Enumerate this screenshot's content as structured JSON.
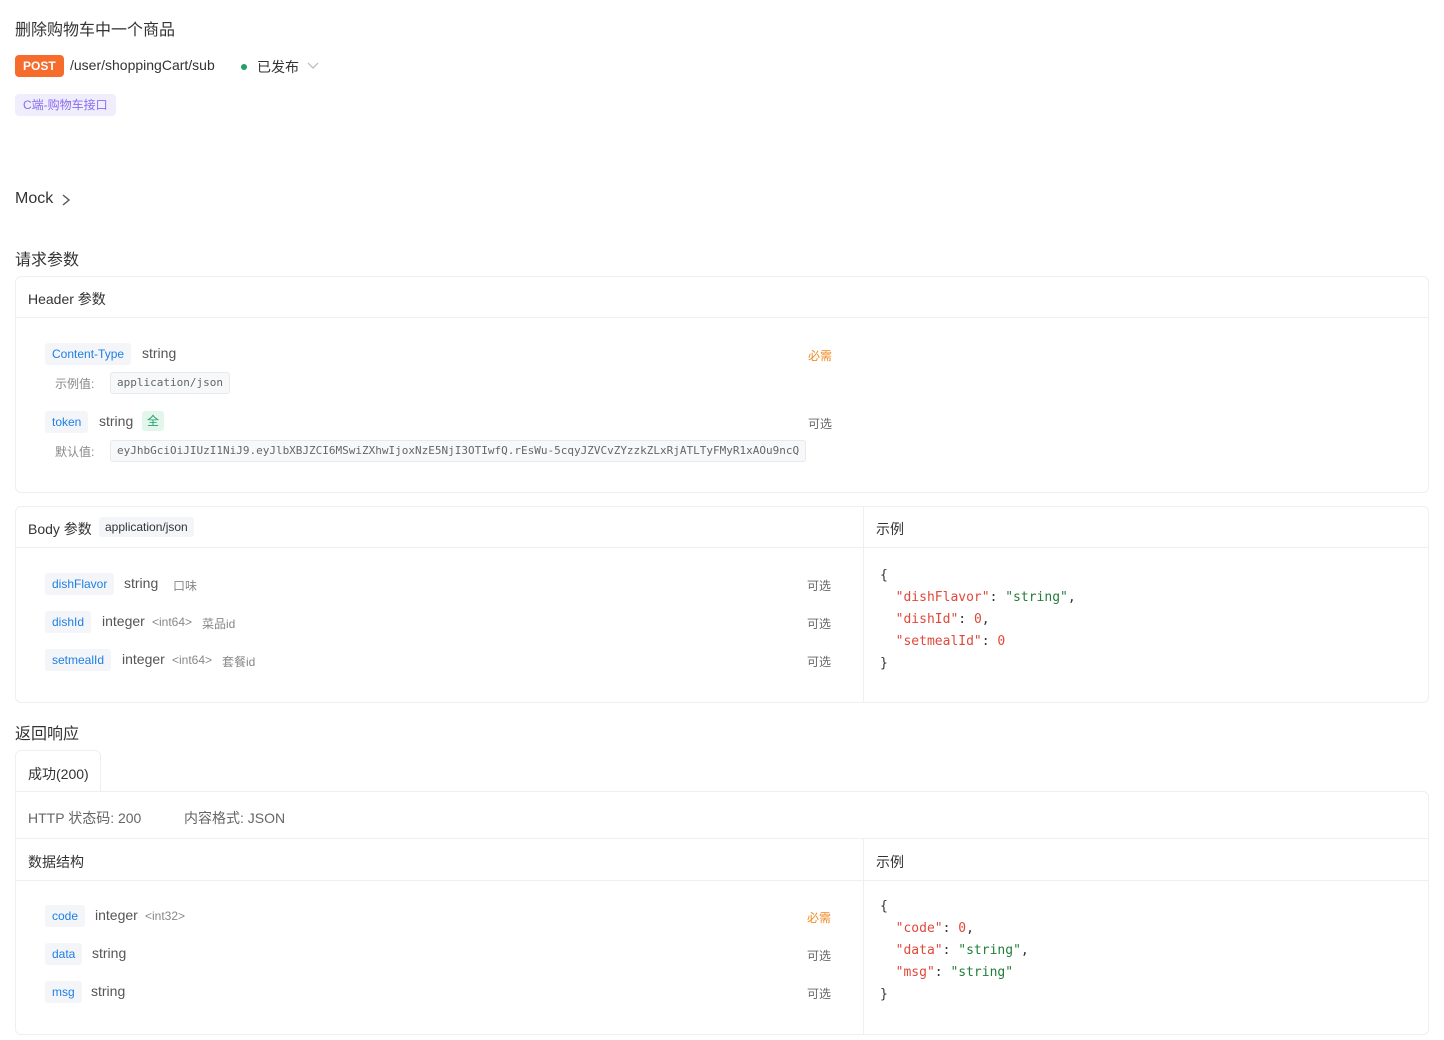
{
  "title": "删除购物车中一个商品",
  "method": "POST",
  "path": "/user/shoppingCart/sub",
  "status": "已发布",
  "tag": "C端-购物车接口",
  "mock_label": "Mock",
  "request_params_title": "请求参数",
  "header_params": {
    "title": "Header 参数",
    "params": [
      {
        "name": "Content-Type",
        "type": "string",
        "required": "必需",
        "value_label": "示例值:",
        "value": "application/json"
      },
      {
        "name": "token",
        "type": "string",
        "badge": "全",
        "required": "可选",
        "value_label": "默认值:",
        "value": "eyJhbGciOiJIUzI1NiJ9.eyJlbXBJZCI6MSwiZXhwIjoxNzE5NjI3OTIwfQ.rEsWu-5cqyJZVCvZYzzkZLxRjATLTyFMyR1xAOu9ncQ"
      }
    ]
  },
  "body_params": {
    "title": "Body 参数",
    "content_type": "application/json",
    "example_title": "示例",
    "params": [
      {
        "name": "dishFlavor",
        "type": "string",
        "format": "",
        "desc": "口味",
        "required": "可选"
      },
      {
        "name": "dishId",
        "type": "integer",
        "format": "<int64>",
        "desc": "菜品id",
        "required": "可选"
      },
      {
        "name": "setmealId",
        "type": "integer",
        "format": "<int64>",
        "desc": "套餐id",
        "required": "可选"
      }
    ],
    "example": [
      {
        "key": "\"dishFlavor\"",
        "value": "\"string\"",
        "kind": "s"
      },
      {
        "key": "\"dishId\"",
        "value": "0",
        "kind": "n"
      },
      {
        "key": "\"setmealId\"",
        "value": "0",
        "kind": "n"
      }
    ]
  },
  "response": {
    "title": "返回响应",
    "tab_label": "成功(200)",
    "http_status": "HTTP 状态码: 200",
    "content_format": "内容格式: JSON",
    "structure_title": "数据结构",
    "example_title": "示例",
    "fields": [
      {
        "name": "code",
        "type": "integer",
        "format": "<int32>",
        "required": "必需"
      },
      {
        "name": "data",
        "type": "string",
        "format": "",
        "required": "可选"
      },
      {
        "name": "msg",
        "type": "string",
        "format": "",
        "required": "可选"
      }
    ],
    "example": [
      {
        "key": "\"code\"",
        "value": "0",
        "kind": "n"
      },
      {
        "key": "\"data\"",
        "value": "\"string\"",
        "kind": "s"
      },
      {
        "key": "\"msg\"",
        "value": "\"string\"",
        "kind": "s"
      }
    ]
  },
  "colors": {
    "method": "#f56c2d",
    "status_dot": "#23a067",
    "tag_text": "#8b6cf0",
    "param_name": "#1f7fe6",
    "required": "#f08a24"
  }
}
